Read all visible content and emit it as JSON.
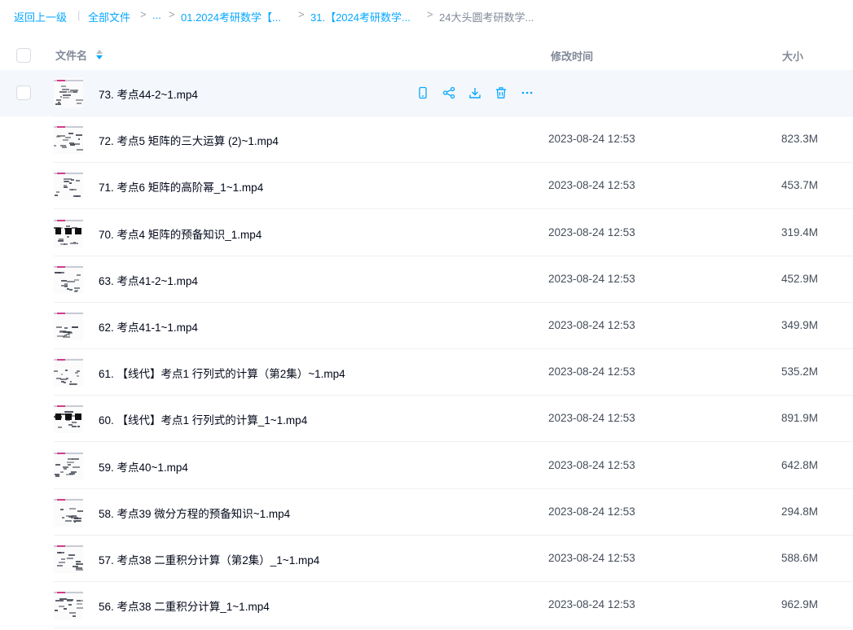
{
  "breadcrumb": {
    "back": "返回上一级",
    "divider": "|",
    "items": [
      "全部文件",
      "...",
      "01.2024考研数学【...",
      "31.【2024考研数学...",
      "24大头圆考研数学..."
    ],
    "separator": ">"
  },
  "header": {
    "name": "文件名",
    "time": "修改时间",
    "size": "大小"
  },
  "colors": {
    "accent": "#06a7ff",
    "text": "#03081a",
    "muted": "#818999",
    "hover": "#f4f7fb"
  },
  "hover_actions": [
    "phone-icon",
    "share-icon",
    "download-icon",
    "delete-icon",
    "more-icon"
  ],
  "rows": [
    {
      "name": "73. 考点44-2~1.mp4",
      "time": "",
      "size": ""
    },
    {
      "name": "72. 考点5 矩阵的三大运算 (2)~1.mp4",
      "time": "2023-08-24 12:53",
      "size": "823.3M"
    },
    {
      "name": "71. 考点6 矩阵的高阶幂_1~1.mp4",
      "time": "2023-08-24 12:53",
      "size": "453.7M"
    },
    {
      "name": "70. 考点4 矩阵的预备知识_1.mp4",
      "time": "2023-08-24 12:53",
      "size": "319.4M"
    },
    {
      "name": "63. 考点41-2~1.mp4",
      "time": "2023-08-24 12:53",
      "size": "452.9M"
    },
    {
      "name": "62. 考点41-1~1.mp4",
      "time": "2023-08-24 12:53",
      "size": "349.9M"
    },
    {
      "name": "61. 【线代】考点1 行列式的计算（第2集）~1.mp4",
      "time": "2023-08-24 12:53",
      "size": "535.2M"
    },
    {
      "name": "60. 【线代】考点1 行列式的计算_1~1.mp4",
      "time": "2023-08-24 12:53",
      "size": "891.9M"
    },
    {
      "name": "59. 考点40~1.mp4",
      "time": "2023-08-24 12:53",
      "size": "642.8M"
    },
    {
      "name": "58. 考点39 微分方程的预备知识~1.mp4",
      "time": "2023-08-24 12:53",
      "size": "294.8M"
    },
    {
      "name": "57. 考点38 二重积分计算（第2集）_1~1.mp4",
      "time": "2023-08-24 12:53",
      "size": "588.6M"
    },
    {
      "name": "56. 考点38 二重积分计算_1~1.mp4",
      "time": "2023-08-24 12:53",
      "size": "962.9M"
    }
  ]
}
